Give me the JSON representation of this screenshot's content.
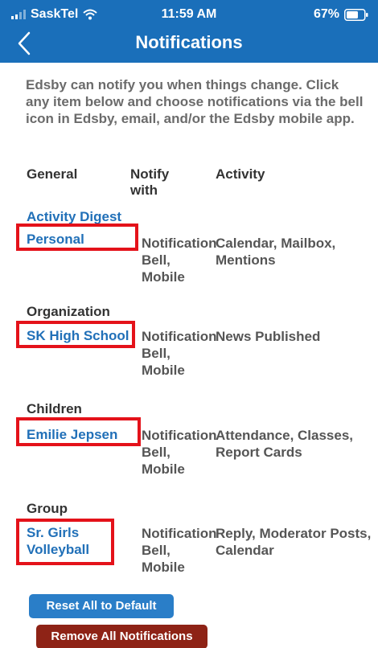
{
  "status_bar": {
    "carrier": "SaskTel",
    "time": "11:59 AM",
    "battery": "67%"
  },
  "nav": {
    "title": "Notifications",
    "back_icon": "chevron-left-icon"
  },
  "intro": "Edsby can notify you when things change. Click any item below and choose notifications via the bell icon in Edsby, email, and/or the Edsby mobile app.",
  "columns": {
    "general": "General",
    "notify_with": "Notify with",
    "activity": "Activity"
  },
  "general": {
    "digest": "Activity Digest",
    "personal": {
      "name": "Personal",
      "notify": "Notification Bell, Mobile",
      "activity": "Calendar, Mailbox, Mentions"
    }
  },
  "organization": {
    "title": "Organization",
    "item": {
      "name": "SK High School",
      "notify": "Notification Bell, Mobile",
      "activity": "News Published"
    }
  },
  "children": {
    "title": "Children",
    "item": {
      "name": "Emilie Jepsen",
      "notify": "Notification Bell, Mobile",
      "activity": "Attendance, Classes, Report Cards"
    }
  },
  "group": {
    "title": "Group",
    "item": {
      "name": "Sr. Girls Volleyball",
      "notify": "Notification Bell, Mobile",
      "activity": "Reply, Moderator Posts, Calendar"
    }
  },
  "buttons": {
    "reset": "Reset All to Default",
    "remove": "Remove All Notifications"
  },
  "colors": {
    "header": "#1a6fba",
    "link": "#2170b8",
    "highlight": "#e4121a",
    "reset_button": "#2a7ec8",
    "remove_button": "#8e2316"
  }
}
